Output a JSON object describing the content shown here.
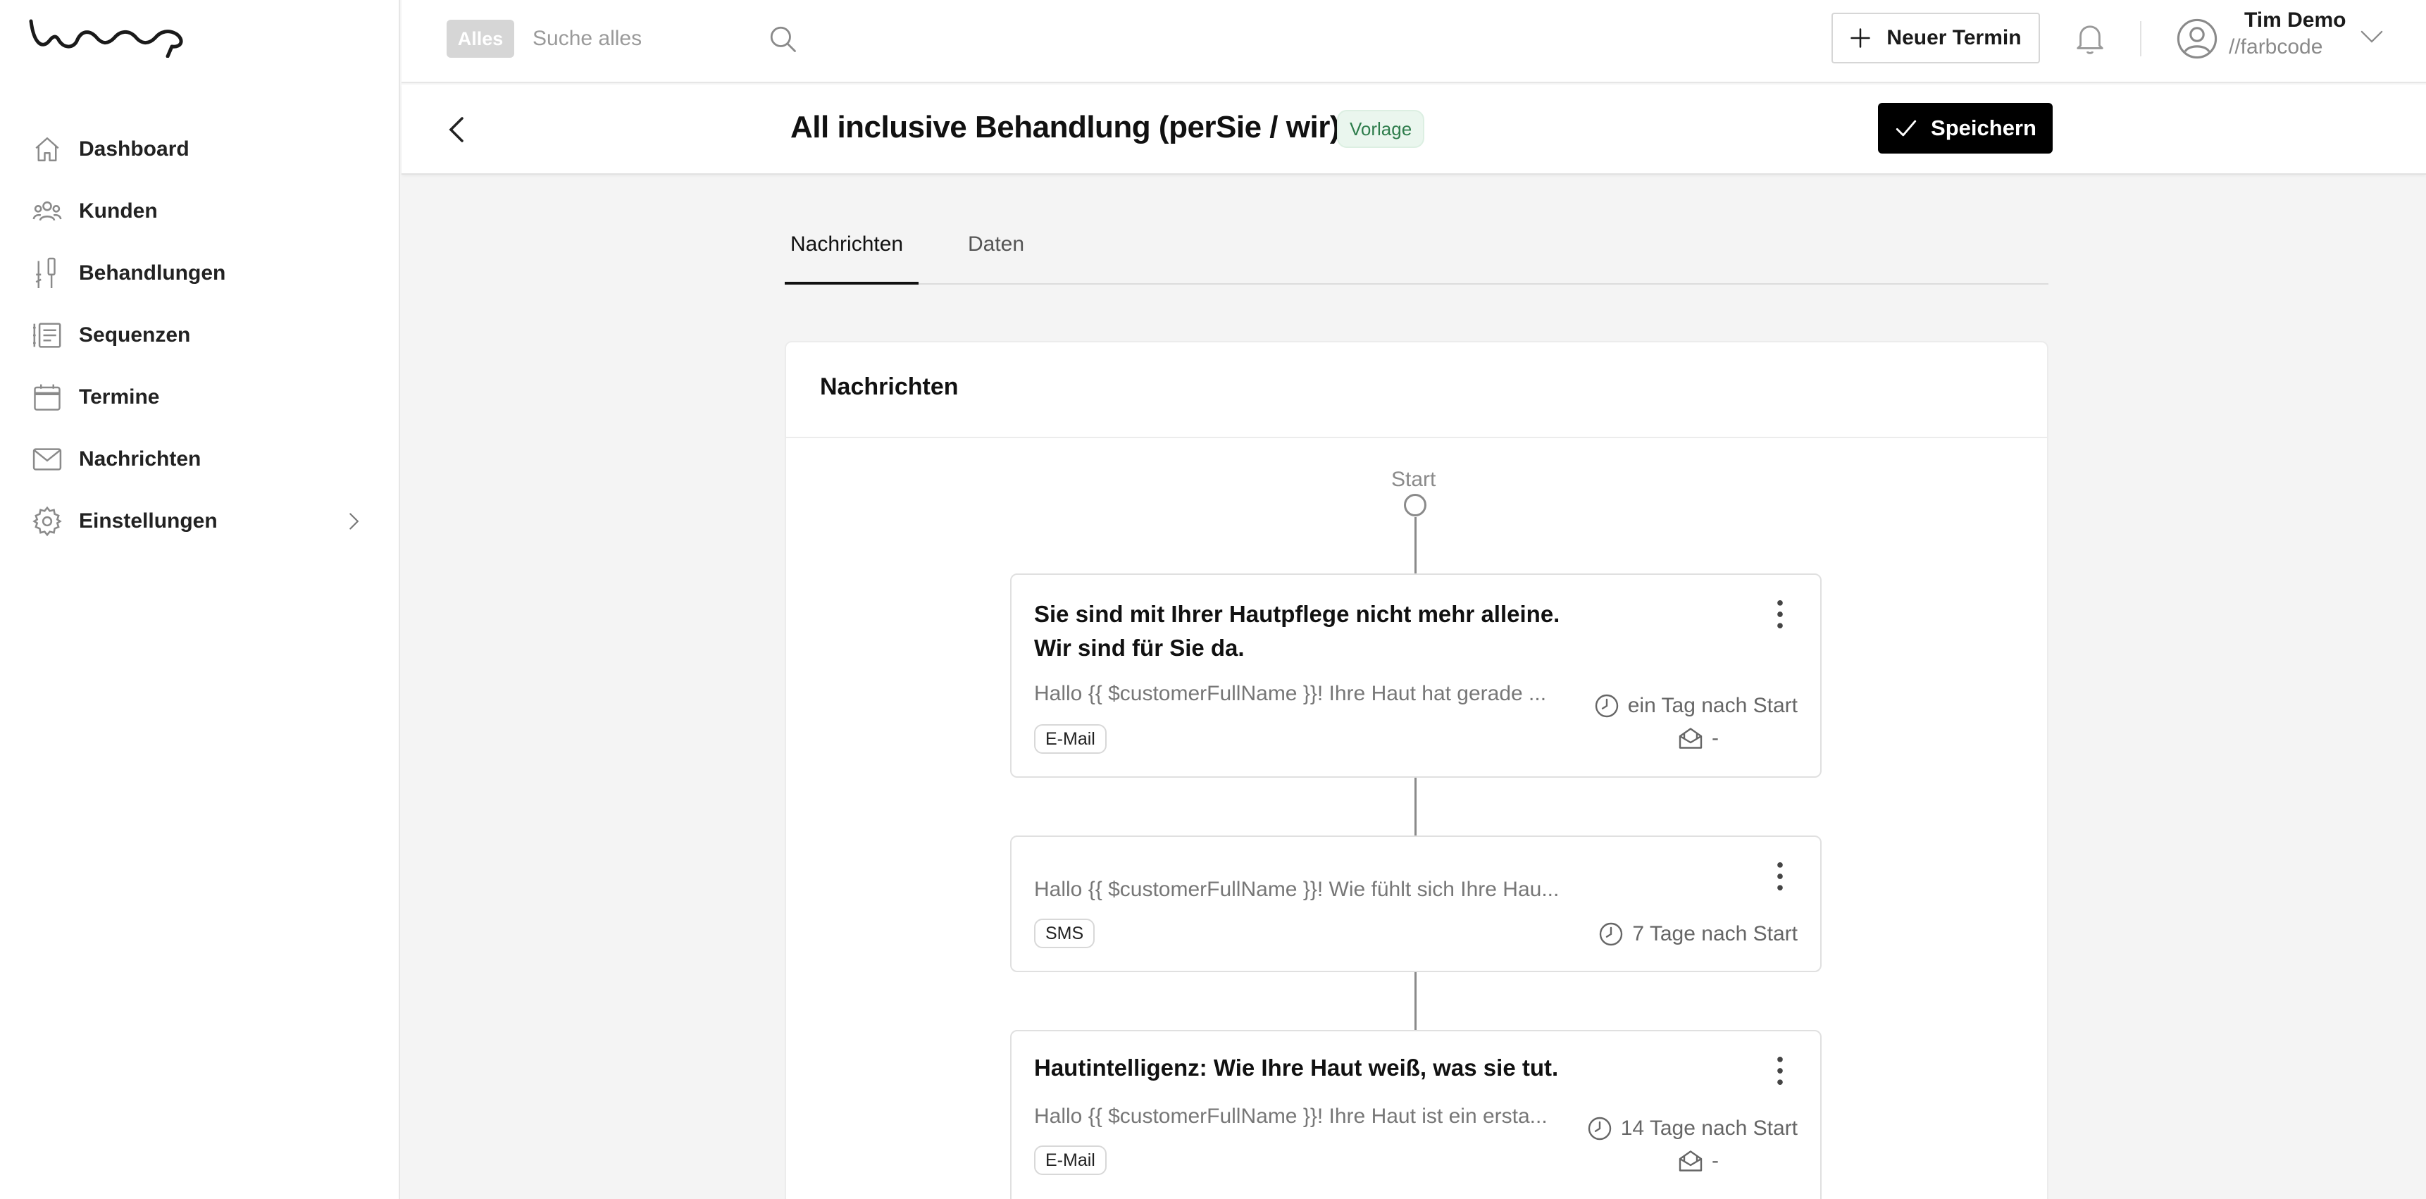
{
  "sidebar": {
    "items": [
      {
        "label": "Dashboard",
        "icon": "home-icon"
      },
      {
        "label": "Kunden",
        "icon": "users-icon"
      },
      {
        "label": "Behandlungen",
        "icon": "tools-icon"
      },
      {
        "label": "Sequenzen",
        "icon": "sequence-icon"
      },
      {
        "label": "Termine",
        "icon": "calendar-icon"
      },
      {
        "label": "Nachrichten",
        "icon": "mail-icon"
      },
      {
        "label": "Einstellungen",
        "icon": "gear-icon"
      }
    ]
  },
  "topbar": {
    "scope": "Alles",
    "search_placeholder": "Suche alles",
    "new_appointment": "Neuer Termin",
    "user_name": "Tim Demo",
    "user_org": "//farbcode"
  },
  "header": {
    "title": "All inclusive Behandlung (perSie / wir)",
    "badge": "Vorlage",
    "save": "Speichern"
  },
  "tabs": [
    {
      "label": "Nachrichten",
      "active": true
    },
    {
      "label": "Daten",
      "active": false
    }
  ],
  "panel": {
    "title": "Nachrichten",
    "start_label": "Start"
  },
  "messages": [
    {
      "title_line1": "Sie sind mit Ihrer Hautpflege nicht mehr alleine.",
      "title_line2": "Wir sind für Sie da.",
      "preview": "Hallo {{ $customerFullName }}! Ihre Haut hat gerade ...",
      "channel": "E-Mail",
      "timing": "ein Tag nach Start",
      "opened": "-"
    },
    {
      "preview": "Hallo {{ $customerFullName }}! Wie fühlt sich Ihre Hau...",
      "channel": "SMS",
      "timing": "7 Tage nach Start"
    },
    {
      "title_line1": "Hautintelligenz: Wie Ihre Haut weiß, was sie tut.",
      "preview": "Hallo {{ $customerFullName }}! Ihre Haut ist ein ersta...",
      "channel": "E-Mail",
      "timing": "14 Tage nach Start",
      "opened": "-"
    }
  ],
  "colors": {
    "accent": "#000000",
    "badge_bg": "#eaf6ee",
    "badge_text": "#2e7d4c"
  }
}
